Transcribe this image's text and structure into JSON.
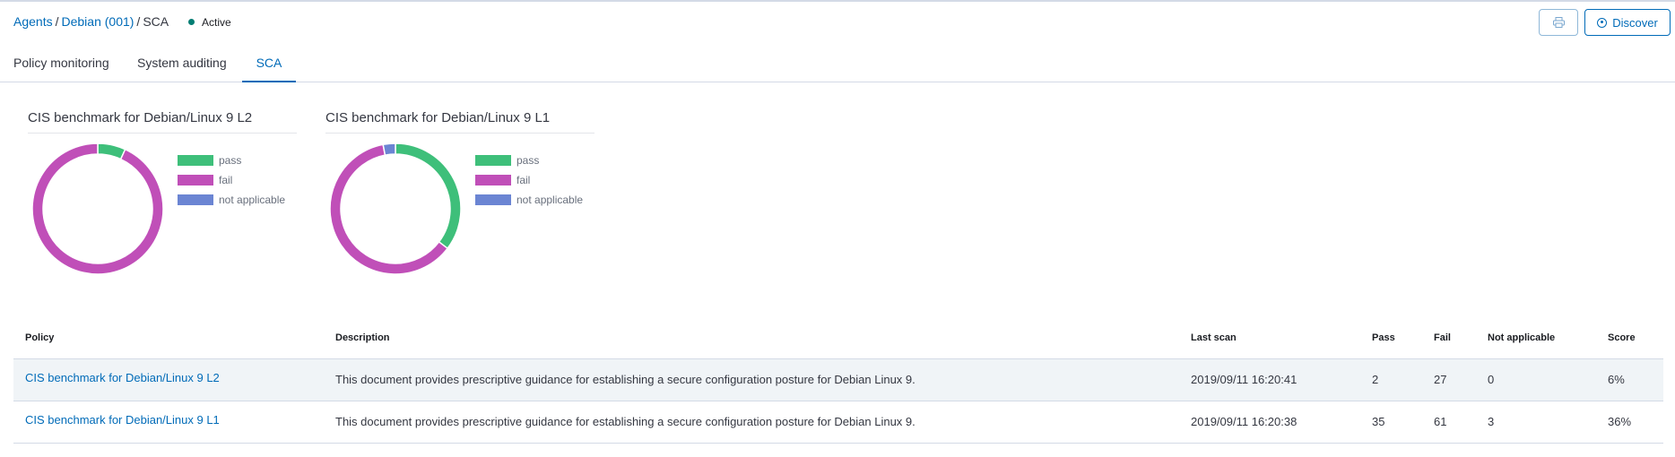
{
  "breadcrumb": {
    "agents": "Agents",
    "separator": "/",
    "agent": "Debian (001)",
    "current": "SCA"
  },
  "status": {
    "label": "Active",
    "color": "#017d73"
  },
  "actions": {
    "print_icon": "print-icon",
    "discover_icon": "compass-icon",
    "discover_label": "Discover"
  },
  "tabs": [
    {
      "label": "Policy monitoring"
    },
    {
      "label": "System auditing"
    },
    {
      "label": "SCA",
      "active": true
    }
  ],
  "colors": {
    "pass": "#3ebf7a",
    "fail": "#c04fb8",
    "not_applicable": "#6b85d3"
  },
  "legend": {
    "pass": "pass",
    "fail": "fail",
    "not_applicable": "not applicable"
  },
  "charts": [
    {
      "title": "CIS benchmark for Debian/Linux 9 L2",
      "chart_data": {
        "type": "pie",
        "labels": [
          "pass",
          "fail",
          "not applicable"
        ],
        "values": [
          2,
          27,
          0
        ]
      }
    },
    {
      "title": "CIS benchmark for Debian/Linux 9 L1",
      "chart_data": {
        "type": "pie",
        "labels": [
          "pass",
          "fail",
          "not applicable"
        ],
        "values": [
          35,
          61,
          3
        ]
      }
    }
  ],
  "table": {
    "headers": {
      "policy": "Policy",
      "description": "Description",
      "last_scan": "Last scan",
      "pass": "Pass",
      "fail": "Fail",
      "not_applicable": "Not applicable",
      "score": "Score"
    },
    "rows": [
      {
        "policy": "CIS benchmark for Debian/Linux 9 L2",
        "description": "This document provides prescriptive guidance for establishing a secure configuration posture for Debian Linux 9.",
        "last_scan": "2019/09/11 16:20:41",
        "pass": "2",
        "fail": "27",
        "not_applicable": "0",
        "score": "6%"
      },
      {
        "policy": "CIS benchmark for Debian/Linux 9 L1",
        "description": "This document provides prescriptive guidance for establishing a secure configuration posture for Debian Linux 9.",
        "last_scan": "2019/09/11 16:20:38",
        "pass": "35",
        "fail": "61",
        "not_applicable": "3",
        "score": "36%"
      }
    ]
  }
}
